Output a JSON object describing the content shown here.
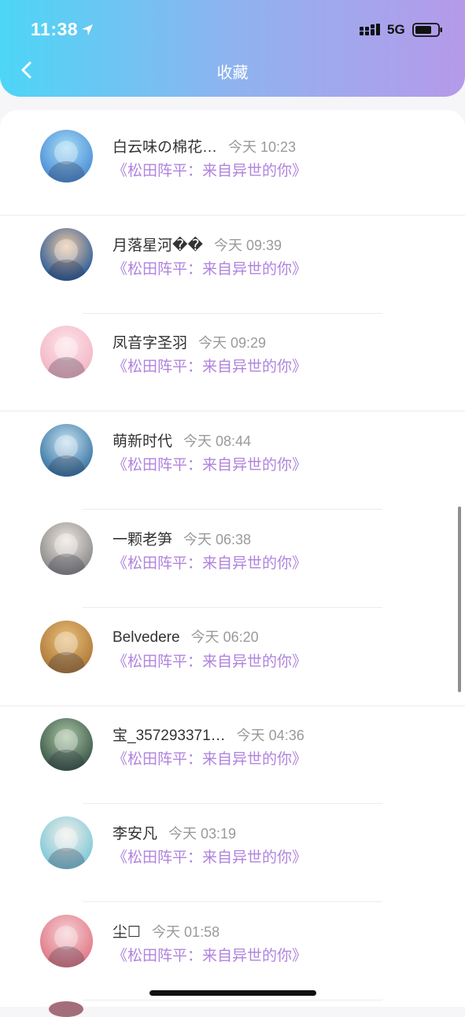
{
  "status_bar": {
    "time": "11:38",
    "network": "5G",
    "location_icon": "location-arrow-icon",
    "signal_icon": "cellular-signal-icon",
    "battery_icon": "battery-icon"
  },
  "header": {
    "title": "收藏",
    "back_icon": "chevron-left-icon",
    "gradient": [
      "#4dd6f6",
      "#8fb3ef",
      "#b59aea"
    ]
  },
  "colors": {
    "accent": "#b083de",
    "name": "#333333",
    "time": "#9a9a9a"
  },
  "items": [
    {
      "name": "白云味の棉花…",
      "time": "今天 10:23",
      "book": "《松田阵平：来自异世的你》",
      "avatar_color": "#4d8fd8",
      "avatar_color2": "#a7def5"
    },
    {
      "name": "月落星河��",
      "time": "今天 09:39",
      "book": "《松田阵平：来自异世的你》",
      "avatar_color": "#2f5f9a",
      "avatar_color2": "#f0c9a2"
    },
    {
      "name": "凤音字圣羽",
      "time": "今天 09:29",
      "book": "《松田阵平：来自异世的你》",
      "avatar_color": "#f3b7c6",
      "avatar_color2": "#fde4ea"
    },
    {
      "name": "萌新时代",
      "time": "今天 08:44",
      "book": "《松田阵平：来自异世的你》",
      "avatar_color": "#3b78a6",
      "avatar_color2": "#c7e2f2"
    },
    {
      "name": "一颗老笋",
      "time": "今天 06:38",
      "book": "《松田阵平：来自异世的你》",
      "avatar_color": "#8b8b8b",
      "avatar_color2": "#efe7e0"
    },
    {
      "name": "Belvedere",
      "time": "今天 06:20",
      "book": "《松田阵平：来自异世的你》",
      "avatar_color": "#b07a3a",
      "avatar_color2": "#e9c07a"
    },
    {
      "name": "宝_357293371…",
      "time": "今天 04:36",
      "book": "《松田阵平：来自异世的你》",
      "avatar_color": "#3e5a4b",
      "avatar_color2": "#a9c5a2"
    },
    {
      "name": "李安凡",
      "time": "今天 03:19",
      "book": "《松田阵平：来自异世的你》",
      "avatar_color": "#7fc8d8",
      "avatar_color2": "#f4f0ea"
    },
    {
      "name": "尘☐",
      "time": "今天 01:58",
      "book": "《松田阵平：来自异世的你》",
      "avatar_color": "#e07a86",
      "avatar_color2": "#f6d0d6"
    }
  ]
}
